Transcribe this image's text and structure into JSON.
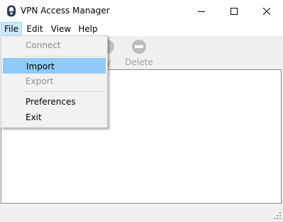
{
  "window": {
    "title": "VPN Access Manager",
    "buttons": {
      "minimize": "minimize-icon",
      "maximize": "maximize-icon",
      "close": "close-icon"
    }
  },
  "menubar": {
    "items": [
      {
        "label": "File",
        "active": true
      },
      {
        "label": "Edit"
      },
      {
        "label": "View"
      },
      {
        "label": "Help"
      }
    ]
  },
  "toolbar": {
    "items": [
      {
        "label": "fy",
        "icon": "modify-icon",
        "enabled": false
      },
      {
        "label": "Delete",
        "icon": "delete-icon",
        "enabled": false
      }
    ]
  },
  "file_menu": {
    "items": [
      {
        "label": "Connect",
        "enabled": false
      },
      {
        "label": "Import",
        "enabled": true,
        "highlighted": true
      },
      {
        "label": "Export",
        "enabled": false
      },
      {
        "label": "Preferences",
        "enabled": true
      },
      {
        "label": "Exit",
        "enabled": true
      }
    ]
  },
  "colors": {
    "menu_active_bg": "#cce8ff",
    "menu_highlight": "#91c9f7",
    "disabled_text": "#8d8d8d"
  }
}
